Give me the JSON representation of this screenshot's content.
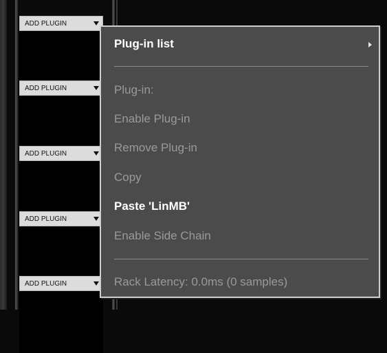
{
  "rack": {
    "add_plugin_label": "ADD PLUGIN",
    "slots": [
      {
        "label": "ADD PLUGIN"
      },
      {
        "label": "ADD PLUGIN"
      },
      {
        "label": "ADD PLUGIN"
      },
      {
        "label": "ADD PLUGIN"
      },
      {
        "label": "ADD PLUGIN"
      }
    ]
  },
  "context_menu": {
    "plugin_list": "Plug-in list",
    "plugin": "Plug-in:",
    "enable_plugin": "Enable Plug-in",
    "remove_plugin": "Remove Plug-in",
    "copy": "Copy",
    "paste": "Paste 'LinMB'",
    "enable_side_chain": "Enable Side Chain",
    "rack_latency": "Rack Latency: 0.0ms (0 samples)"
  },
  "colors": {
    "menu_bg": "#4b4b4b",
    "enabled_text": "#ffffff",
    "disabled_text": "#9a9a9a",
    "button_bg": "#dcdcdc"
  }
}
